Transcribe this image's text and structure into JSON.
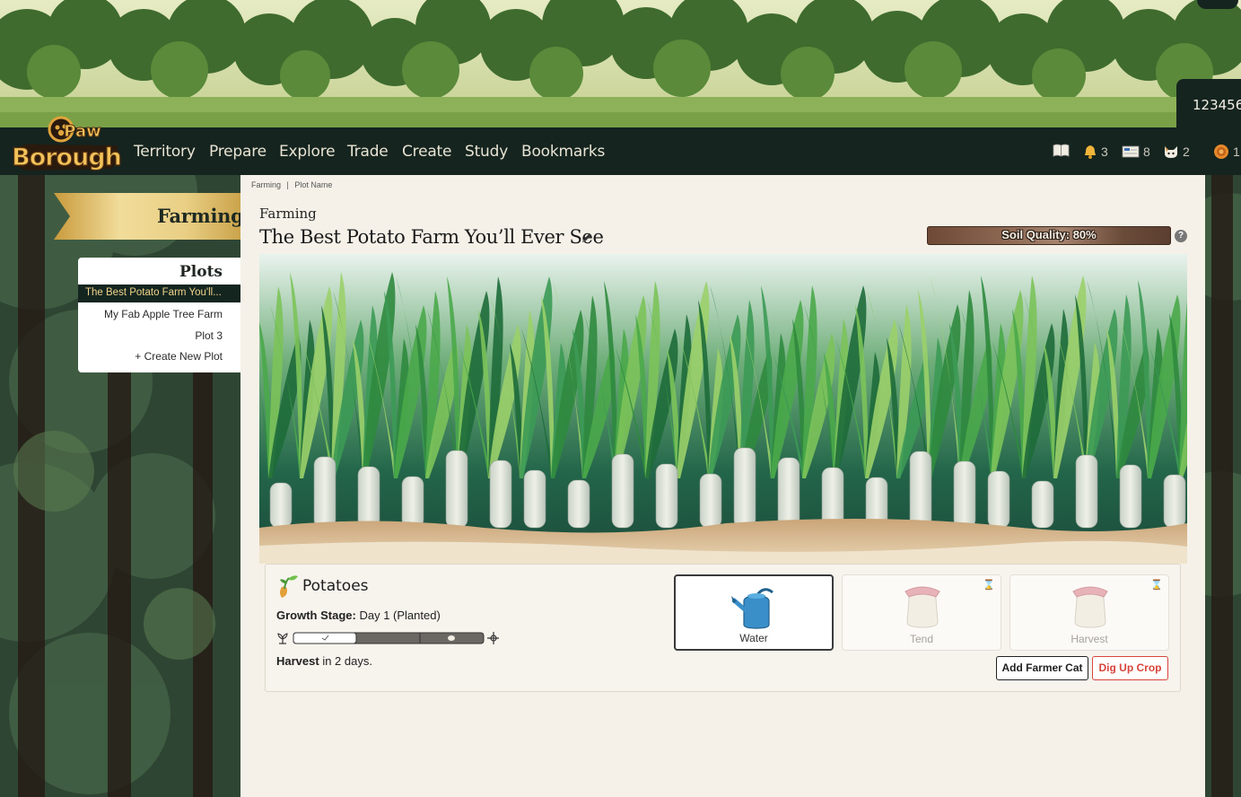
{
  "nav": {
    "links": [
      "Territory",
      "Prepare",
      "Explore",
      "Trade",
      "Create",
      "Study",
      "Bookmarks"
    ],
    "stats": {
      "notifications": "3",
      "mail": "8",
      "cats": "2",
      "currency": "1"
    },
    "user_id": "123456"
  },
  "logo": {
    "line1": "Paw",
    "line2": "Borough"
  },
  "sidebar": {
    "section_title": "Farming",
    "plots_title": "Plots",
    "plots": [
      "The Best Potato Farm You'll...",
      "My Fab Apple Tree Farm",
      "Plot 3"
    ],
    "create_label": "+ Create New Plot"
  },
  "breadcrumb": [
    "Farming",
    "|",
    "Plot Name"
  ],
  "page": {
    "kicker": "Farming",
    "title": "The Best Potato Farm You’ll Ever See",
    "soil_quality_label": "Soil Quality: 80%",
    "soil_quality": 80,
    "help": "?"
  },
  "crop": {
    "name": "Potatoes",
    "growth_label": "Growth Stage:",
    "growth_value": "Day 1 (Planted)",
    "harvest_label": "Harvest",
    "harvest_value": "in 2 days.",
    "progress": 0.33
  },
  "actions": [
    {
      "label": "Water",
      "state": "active"
    },
    {
      "label": "Tend",
      "state": "disabled"
    },
    {
      "label": "Harvest",
      "state": "disabled"
    }
  ],
  "buttons": {
    "add_cat": "Add Farmer Cat",
    "dig_up": "Dig Up Crop"
  },
  "colors": {
    "nav_bg": "#15241f",
    "accent_gold": "#d9b45a",
    "danger": "#d8443a",
    "content_bg": "#f5f1e8"
  }
}
